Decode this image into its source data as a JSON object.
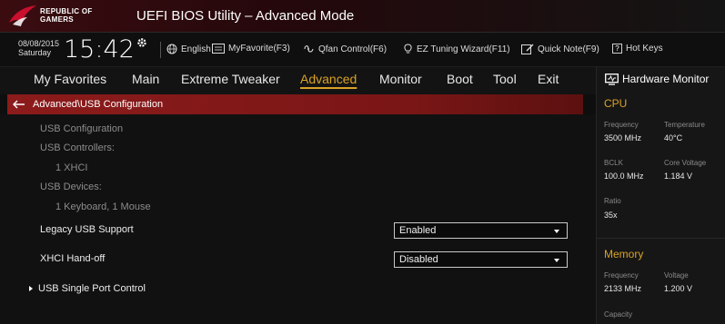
{
  "app": {
    "brand_line1": "REPUBLIC OF",
    "brand_line2": "GAMERS",
    "title": "UEFI BIOS Utility – Advanced Mode"
  },
  "infobar": {
    "date": "08/08/2015",
    "day": "Saturday",
    "time": "15:42",
    "tools": [
      {
        "label": "English",
        "icon": "globe-icon"
      },
      {
        "label": "MyFavorite(F3)",
        "icon": "favorite-icon"
      },
      {
        "label": "Qfan Control(F6)",
        "icon": "fan-icon"
      },
      {
        "label": "EZ Tuning Wizard(F11)",
        "icon": "bulb-icon"
      },
      {
        "label": "Quick Note(F9)",
        "icon": "note-icon"
      },
      {
        "label": "Hot Keys",
        "icon": "hotkeys-icon",
        "key": "?"
      }
    ]
  },
  "nav": {
    "tabs": [
      "My Favorites",
      "Main",
      "Extreme Tweaker",
      "Advanced",
      "Monitor",
      "Boot",
      "Tool",
      "Exit"
    ],
    "active": "Advanced"
  },
  "breadcrumb": "Advanced\\USB Configuration",
  "main": {
    "usb_configuration": "USB Configuration",
    "usb_controllers_label": "USB Controllers:",
    "usb_controllers_value": "1 XHCI",
    "usb_devices_label": "USB Devices:",
    "usb_devices_value": "1 Keyboard, 1 Mouse",
    "legacy_usb": {
      "label": "Legacy USB Support",
      "value": "Enabled"
    },
    "xhci_handoff": {
      "label": "XHCI Hand-off",
      "value": "Disabled"
    },
    "single_port": "USB Single Port Control"
  },
  "hw_monitor": {
    "title": "Hardware Monitor",
    "cpu": {
      "heading": "CPU",
      "frequency_label": "Frequency",
      "frequency": "3500 MHz",
      "temperature_label": "Temperature",
      "temperature": "40°C",
      "bclk_label": "BCLK",
      "bclk": "100.0 MHz",
      "core_voltage_label": "Core Voltage",
      "core_voltage": "1.184 V",
      "ratio_label": "Ratio",
      "ratio": "35x"
    },
    "memory": {
      "heading": "Memory",
      "frequency_label": "Frequency",
      "frequency": "2133 MHz",
      "voltage_label": "Voltage",
      "voltage": "1.200 V",
      "capacity_label": "Capacity"
    }
  },
  "colors": {
    "accent": "#d9a327",
    "breadcrumb": "#8c1b1b",
    "background": "#111111"
  }
}
